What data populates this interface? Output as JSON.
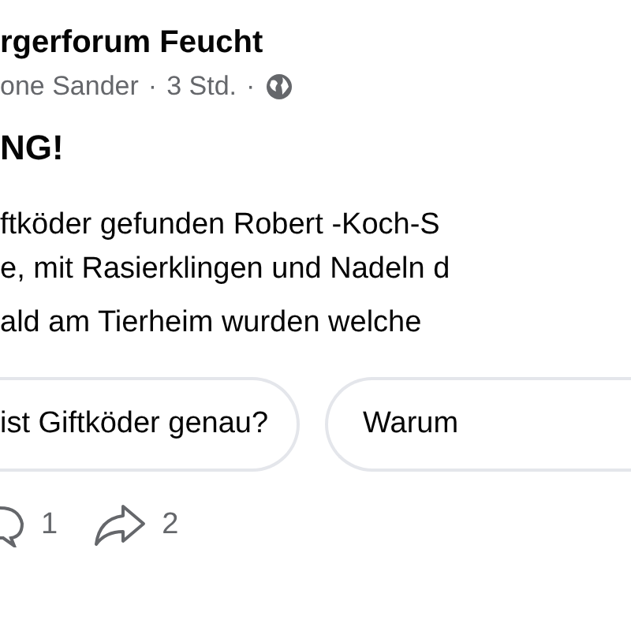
{
  "post": {
    "group_name": "rgerforum Feucht",
    "author": "one Sander",
    "time": "3 Std.",
    "separator": "·",
    "headline": "NG!",
    "body_lines": [
      "ftköder gefunden Robert -Koch-S",
      "e, mit Rasierklingen und Nadeln d"
    ],
    "body_paragraph": "ald am Tierheim wurden welche"
  },
  "suggestions": [
    {
      "label": "ist Giftköder genau?"
    },
    {
      "label": "Warum"
    }
  ],
  "actions": [
    {
      "kind": "comment",
      "count": "1"
    },
    {
      "kind": "share",
      "count": "2"
    }
  ]
}
